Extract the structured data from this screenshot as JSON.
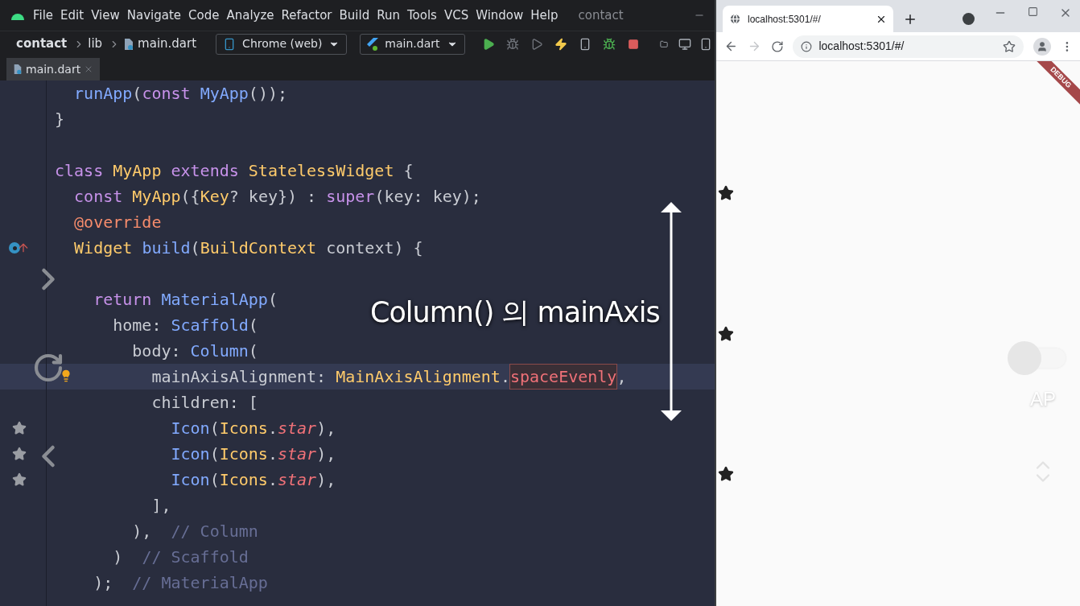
{
  "ide": {
    "menu": [
      "File",
      "Edit",
      "View",
      "Navigate",
      "Code",
      "Analyze",
      "Refactor",
      "Build",
      "Run",
      "Tools",
      "VCS",
      "Window",
      "Help"
    ],
    "project_title": "contact",
    "breadcrumbs": [
      "contact",
      "lib",
      "main.dart"
    ],
    "device": "Chrome (web)",
    "run_config": "main.dart",
    "editor_tabs": [
      {
        "label": "main.dart",
        "selected": true
      }
    ],
    "code_lines": [
      {
        "kind": "code",
        "current": false,
        "tokens": [
          {
            "kind": "func",
            "text": "  runApp"
          },
          {
            "kind": "plain",
            "text": "("
          },
          {
            "kind": "keyword",
            "text": "const "
          },
          {
            "kind": "func",
            "text": "MyApp"
          },
          {
            "kind": "plain",
            "text": "());"
          }
        ]
      },
      {
        "kind": "code",
        "current": false,
        "tokens": [
          {
            "kind": "plain",
            "text": "}"
          }
        ]
      },
      {
        "kind": "blank"
      },
      {
        "kind": "code",
        "current": false,
        "tokens": [
          {
            "kind": "keyword",
            "text": "class "
          },
          {
            "kind": "type",
            "text": "MyApp "
          },
          {
            "kind": "keyword",
            "text": "extends "
          },
          {
            "kind": "type",
            "text": "StatelessWidget"
          },
          {
            "kind": "plain",
            "text": " {"
          }
        ]
      },
      {
        "kind": "code",
        "current": false,
        "tokens": [
          {
            "kind": "keyword",
            "text": "  const "
          },
          {
            "kind": "type",
            "text": "MyApp"
          },
          {
            "kind": "plain",
            "text": "({"
          },
          {
            "kind": "type",
            "text": "Key"
          },
          {
            "kind": "plain",
            "text": "? key}) : "
          },
          {
            "kind": "keyword",
            "text": "super"
          },
          {
            "kind": "plain",
            "text": "(key: key);"
          }
        ]
      },
      {
        "kind": "code",
        "current": false,
        "tokens": [
          {
            "kind": "meta",
            "text": "  @override"
          }
        ]
      },
      {
        "kind": "override",
        "current": false,
        "tokens": [
          {
            "kind": "type",
            "text": "  Widget "
          },
          {
            "kind": "func",
            "text": "build"
          },
          {
            "kind": "plain",
            "text": "("
          },
          {
            "kind": "type",
            "text": "BuildContext"
          },
          {
            "kind": "plain",
            "text": " context) {"
          }
        ]
      },
      {
        "kind": "blank"
      },
      {
        "kind": "code",
        "current": false,
        "tokens": [
          {
            "kind": "keyword",
            "text": "    return "
          },
          {
            "kind": "func",
            "text": "MaterialApp"
          },
          {
            "kind": "plain",
            "text": "("
          }
        ]
      },
      {
        "kind": "code",
        "current": false,
        "tokens": [
          {
            "kind": "plain",
            "text": "      home: "
          },
          {
            "kind": "func",
            "text": "Scaffold"
          },
          {
            "kind": "plain",
            "text": "("
          }
        ]
      },
      {
        "kind": "code",
        "current": false,
        "tokens": [
          {
            "kind": "plain",
            "text": "        body: "
          },
          {
            "kind": "func",
            "text": "Column"
          },
          {
            "kind": "plain",
            "text": "("
          }
        ]
      },
      {
        "kind": "intention",
        "current": true,
        "tokens": [
          {
            "kind": "plain",
            "text": "          mainAxisAlignment: "
          },
          {
            "kind": "type",
            "text": "MainAxisAlignment"
          },
          {
            "kind": "plain",
            "text": "."
          },
          {
            "kind": "highlight",
            "text": "spaceEvenly"
          },
          {
            "kind": "plain",
            "text": ","
          }
        ]
      },
      {
        "kind": "code",
        "current": false,
        "tokens": [
          {
            "kind": "plain",
            "text": "          children: ["
          }
        ]
      },
      {
        "kind": "icon_preview",
        "current": false,
        "tokens": [
          {
            "kind": "func",
            "text": "            Icon"
          },
          {
            "kind": "plain",
            "text": "("
          },
          {
            "kind": "type",
            "text": "Icons"
          },
          {
            "kind": "plain",
            "text": "."
          },
          {
            "kind": "field",
            "text": "star"
          },
          {
            "kind": "plain",
            "text": "),"
          }
        ]
      },
      {
        "kind": "icon_preview",
        "current": false,
        "tokens": [
          {
            "kind": "func",
            "text": "            Icon"
          },
          {
            "kind": "plain",
            "text": "("
          },
          {
            "kind": "type",
            "text": "Icons"
          },
          {
            "kind": "plain",
            "text": "."
          },
          {
            "kind": "field",
            "text": "star"
          },
          {
            "kind": "plain",
            "text": "),"
          }
        ]
      },
      {
        "kind": "icon_preview",
        "current": false,
        "tokens": [
          {
            "kind": "func",
            "text": "            Icon"
          },
          {
            "kind": "plain",
            "text": "("
          },
          {
            "kind": "type",
            "text": "Icons"
          },
          {
            "kind": "plain",
            "text": "."
          },
          {
            "kind": "field",
            "text": "star"
          },
          {
            "kind": "plain",
            "text": "),"
          }
        ]
      },
      {
        "kind": "code",
        "current": false,
        "tokens": [
          {
            "kind": "plain",
            "text": "          ],"
          }
        ]
      },
      {
        "kind": "code",
        "current": false,
        "tokens": [
          {
            "kind": "plain",
            "text": "        ),  "
          },
          {
            "kind": "comment",
            "text": "// Column"
          }
        ]
      },
      {
        "kind": "code",
        "current": false,
        "tokens": [
          {
            "kind": "plain",
            "text": "      )  "
          },
          {
            "kind": "comment",
            "text": "// Scaffold"
          }
        ]
      },
      {
        "kind": "code",
        "current": false,
        "tokens": [
          {
            "kind": "plain",
            "text": "    );  "
          },
          {
            "kind": "comment",
            "text": "// MaterialApp"
          }
        ]
      }
    ]
  },
  "overlay": {
    "caption": "Column() 의 mainAxis"
  },
  "browser": {
    "tab_title": "localhost:5301/#/",
    "url": "localhost:5301/#/",
    "banner": "DEBUG",
    "app_icons": [
      {
        "kind": "star"
      },
      {
        "kind": "star"
      },
      {
        "kind": "star"
      }
    ],
    "toggle": {
      "on": false
    },
    "toggle_label": "AP"
  }
}
